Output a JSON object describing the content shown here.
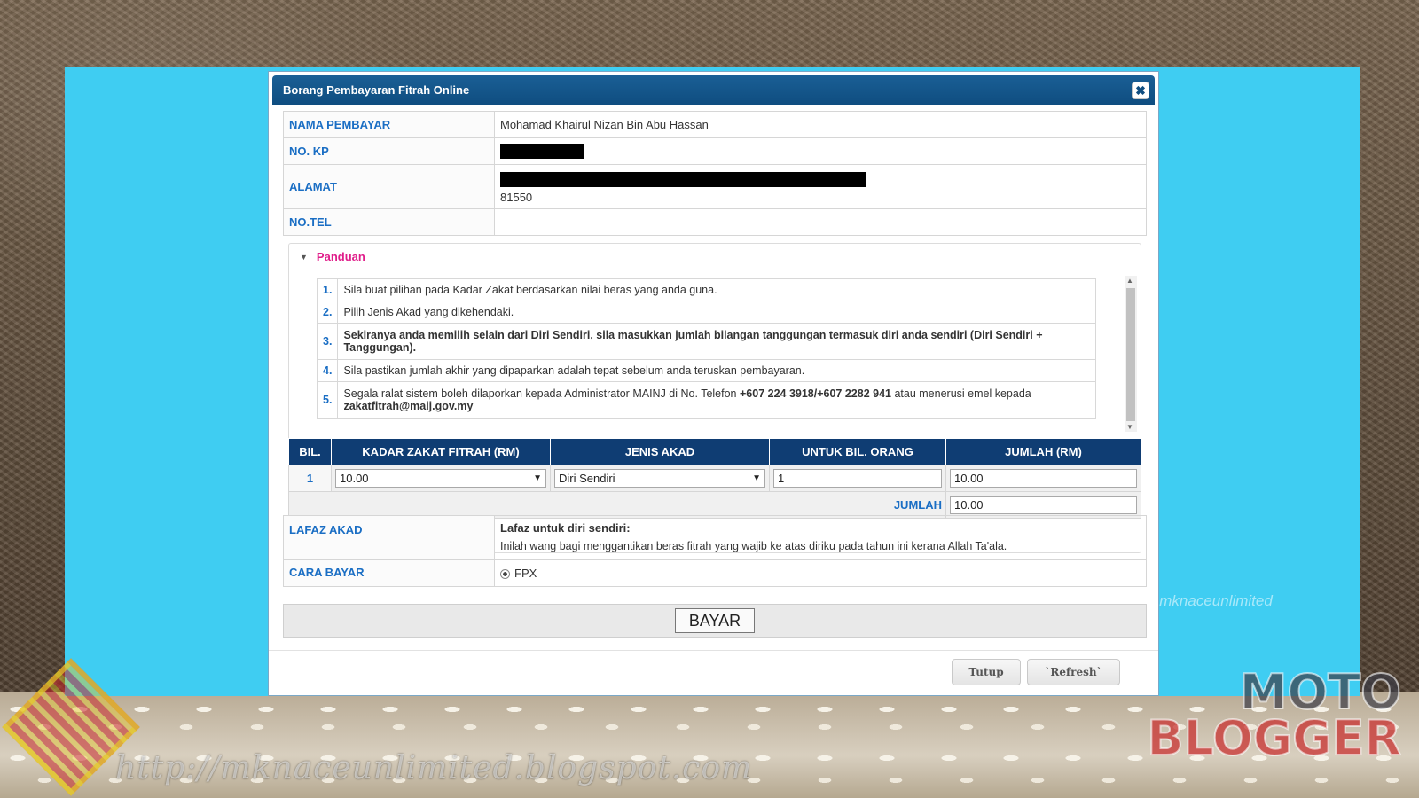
{
  "modal": {
    "title": "Borang Pembayaran Fitrah Online",
    "close_symbol": "✖"
  },
  "info": {
    "nama_label": "NAMA PEMBAYAR",
    "nama_value": "Mohamad Khairul Nizan Bin Abu Hassan",
    "kp_label": "NO. KP",
    "alamat_label": "ALAMAT",
    "alamat_postcode": "81550",
    "tel_label": "NO.TEL",
    "tel_value": ""
  },
  "panduan": {
    "title": "Panduan",
    "steps": [
      {
        "num": "1.",
        "text": "Sila buat pilihan pada Kadar Zakat berdasarkan nilai beras yang anda guna."
      },
      {
        "num": "2.",
        "text": "Pilih Jenis Akad yang dikehendaki."
      },
      {
        "num": "3.",
        "text": "Sekiranya anda memilih selain dari Diri Sendiri, sila masukkan jumlah bilangan tanggungan termasuk diri anda sendiri (Diri Sendiri + Tanggungan)."
      },
      {
        "num": "4.",
        "text": "Sila pastikan jumlah akhir yang dipaparkan adalah tepat sebelum anda teruskan pembayaran."
      },
      {
        "num": "5.",
        "text_prefix": "Segala ralat sistem boleh dilaporkan kepada Administrator MAINJ di No. Telefon ",
        "phone": "+607 224 3918/+607 2282 941",
        "text_mid": " atau menerusi emel kepada ",
        "email": "zakatfitrah@maij.gov.my"
      }
    ]
  },
  "order": {
    "headers": [
      "BIL.",
      "KADAR ZAKAT FITRAH (RM)",
      "JENIS AKAD",
      "UNTUK BIL. ORANG",
      "JUMLAH (RM)"
    ],
    "row": {
      "bil": "1",
      "kadar": "10.00",
      "jenis": "Diri Sendiri",
      "bil_orang": "1",
      "jumlah": "10.00"
    },
    "total_label": "JUMLAH",
    "total_value": "10.00"
  },
  "lafaz": {
    "label": "LAFAZ AKAD",
    "heading": "Lafaz untuk diri sendiri:",
    "text": "Inilah wang bagi menggantikan beras fitrah yang wajib ke atas diriku pada tahun ini kerana Allah Ta'ala."
  },
  "cara_bayar": {
    "label": "CARA BAYAR",
    "option": "FPX"
  },
  "buttons": {
    "bayar": "BAYAR",
    "tutup": "Tutup",
    "refresh": "`Refresh`"
  },
  "watermarks": {
    "url": "http://mknaceunlimited.blogspot.com",
    "side": "@mknaceunlimited",
    "moto_line1": "MOTO",
    "moto_line2": "BLOGGER"
  }
}
